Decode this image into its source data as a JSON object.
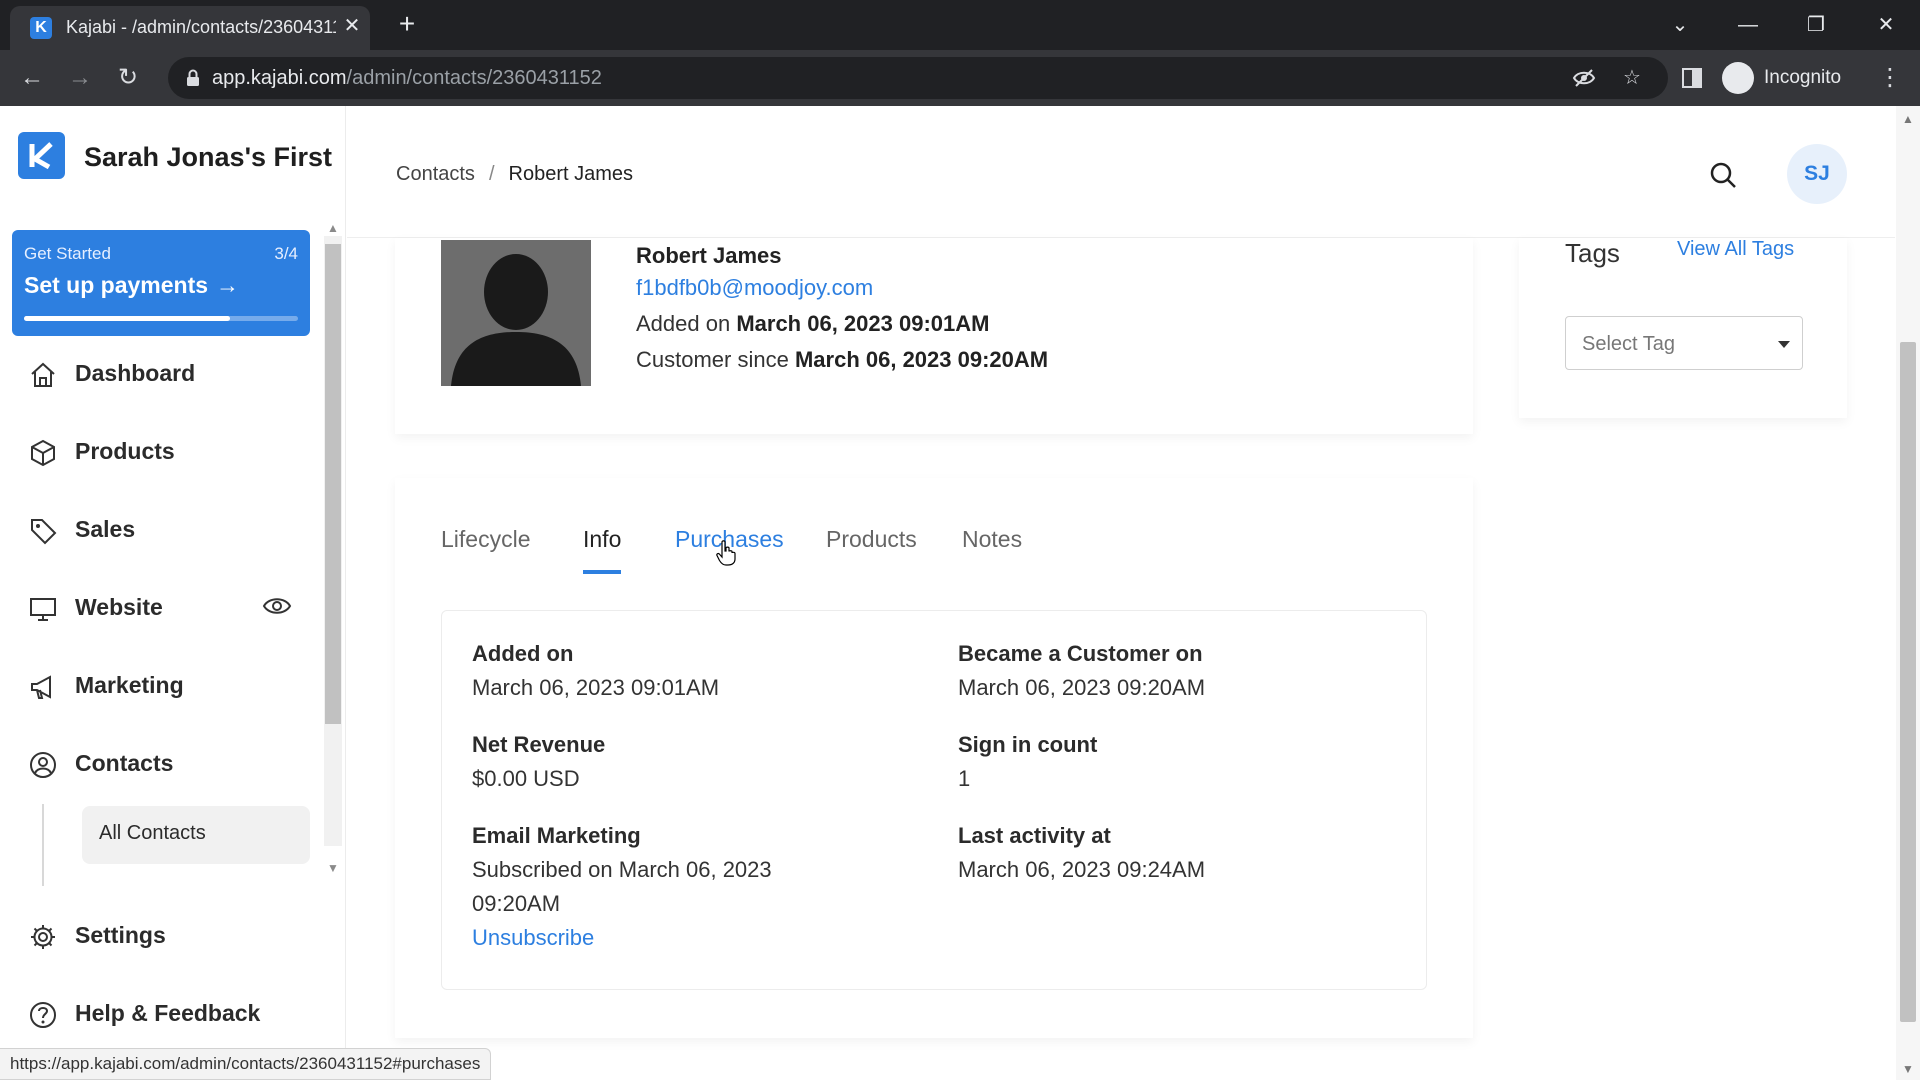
{
  "browser": {
    "tab_title": "Kajabi - /admin/contacts/2360431152",
    "url_host": "app.kajabi.com",
    "url_path": "/admin/contacts/2360431152",
    "profile_label": "Incognito",
    "status_url": "https://app.kajabi.com/admin/contacts/2360431152#purchases"
  },
  "sidebar": {
    "brand_name": "Sarah Jonas's First",
    "get_started": {
      "label": "Get Started",
      "count": "3/4",
      "title": "Set up payments",
      "progress_fraction": 0.75
    },
    "items": [
      {
        "label": "Dashboard",
        "icon": "home-icon"
      },
      {
        "label": "Products",
        "icon": "box-icon"
      },
      {
        "label": "Sales",
        "icon": "tag-icon"
      },
      {
        "label": "Website",
        "icon": "monitor-icon"
      },
      {
        "label": "Marketing",
        "icon": "megaphone-icon"
      },
      {
        "label": "Contacts",
        "icon": "user-circle-icon"
      },
      {
        "label": "Settings",
        "icon": "gear-icon"
      },
      {
        "label": "Help & Feedback",
        "icon": "help-circle-icon"
      }
    ],
    "sub_items": [
      {
        "label": "All Contacts"
      }
    ]
  },
  "header": {
    "breadcrumb": [
      "Contacts",
      "Robert James"
    ],
    "avatar_initials": "SJ"
  },
  "profile": {
    "name": "Robert James",
    "email": "f1bdfb0b@moodjoy.com",
    "added_prefix": "Added on",
    "added_value": "March 06, 2023 09:01AM",
    "customer_prefix": "Customer since",
    "customer_value": "March 06, 2023 09:20AM"
  },
  "tags": {
    "title": "Tags",
    "view_all": "View All Tags",
    "select_placeholder": "Select Tag"
  },
  "tabs": [
    {
      "label": "Lifecycle",
      "state": "normal"
    },
    {
      "label": "Info",
      "state": "active"
    },
    {
      "label": "Purchases",
      "state": "hover"
    },
    {
      "label": "Products",
      "state": "normal"
    },
    {
      "label": "Notes",
      "state": "normal"
    }
  ],
  "info": {
    "added_on": {
      "label": "Added on",
      "value": "March 06, 2023 09:01AM"
    },
    "became_customer": {
      "label": "Became a Customer on",
      "value": "March 06, 2023 09:20AM"
    },
    "net_revenue": {
      "label": "Net Revenue",
      "value": "$0.00 USD"
    },
    "sign_in_count": {
      "label": "Sign in count",
      "value": "1"
    },
    "email_marketing": {
      "label": "Email Marketing",
      "value_line1": "Subscribed on March 06, 2023",
      "value_line2": "09:20AM",
      "link": "Unsubscribe"
    },
    "last_activity": {
      "label": "Last activity at",
      "value": "March 06, 2023 09:24AM"
    }
  },
  "colors": {
    "accent": "#2d7fe0",
    "chrome_dark": "#202124",
    "chrome_mid": "#35363a"
  }
}
